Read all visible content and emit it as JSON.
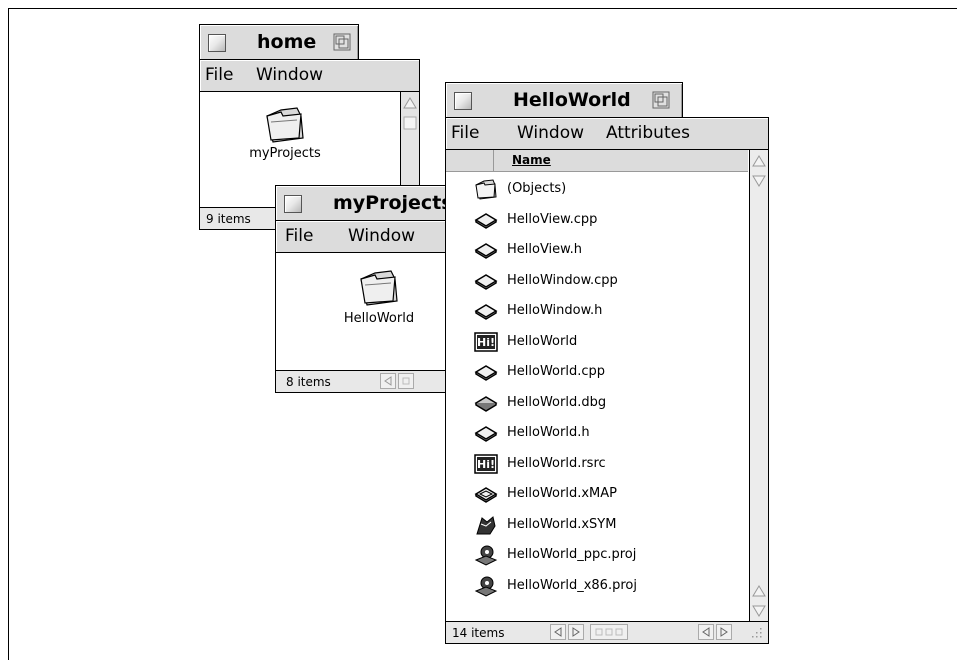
{
  "home": {
    "title": "home",
    "menu": [
      "File",
      "Window"
    ],
    "items": [
      {
        "label": "myProjects",
        "icon": "folder-icon"
      }
    ],
    "status": "9 items"
  },
  "myprojects": {
    "title": "myProjects",
    "menu": [
      "File",
      "Window"
    ],
    "items": [
      {
        "label": "HelloWorld",
        "icon": "folder-icon"
      }
    ],
    "status": "8 items"
  },
  "helloworld": {
    "title": "HelloWorld",
    "menu": [
      "File",
      "Window",
      "Attributes"
    ],
    "column_header": "Name",
    "files": [
      {
        "name": "(Objects)",
        "icon": "folder-icon"
      },
      {
        "name": "HelloView.cpp",
        "icon": "source-file-icon"
      },
      {
        "name": "HelloView.h",
        "icon": "source-file-icon"
      },
      {
        "name": "HelloWindow.cpp",
        "icon": "source-file-icon"
      },
      {
        "name": "HelloWindow.h",
        "icon": "source-file-icon"
      },
      {
        "name": "HelloWorld",
        "icon": "hi-app-icon"
      },
      {
        "name": "HelloWorld.cpp",
        "icon": "source-file-icon"
      },
      {
        "name": "HelloWorld.dbg",
        "icon": "debug-file-icon"
      },
      {
        "name": "HelloWorld.h",
        "icon": "source-file-icon"
      },
      {
        "name": "HelloWorld.rsrc",
        "icon": "hi-resource-icon"
      },
      {
        "name": "HelloWorld.xMAP",
        "icon": "map-file-icon"
      },
      {
        "name": "HelloWorld.xSYM",
        "icon": "sym-file-icon"
      },
      {
        "name": "HelloWorld_ppc.proj",
        "icon": "project-file-icon"
      },
      {
        "name": "HelloWorld_x86.proj",
        "icon": "project-file-icon"
      }
    ],
    "status": "14 items"
  }
}
